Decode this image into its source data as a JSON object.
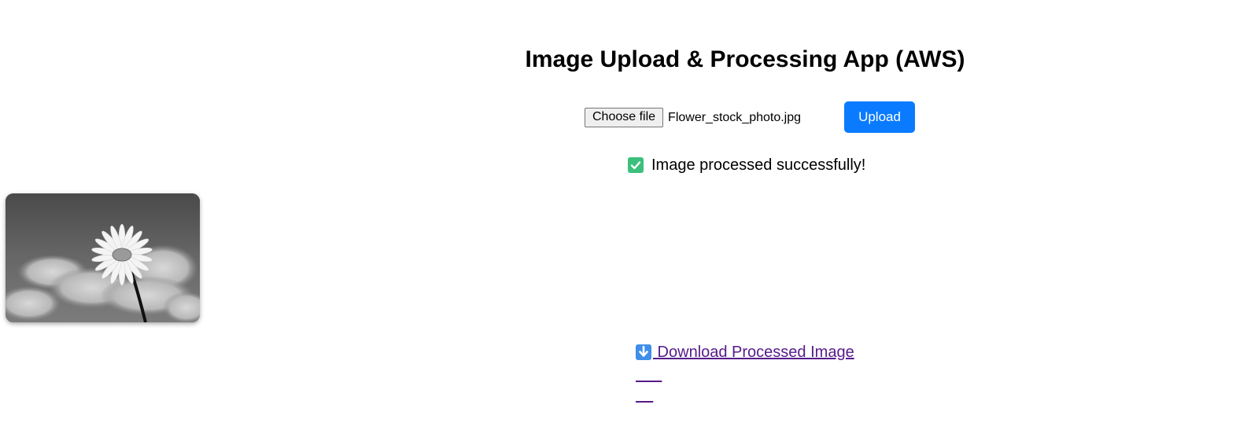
{
  "header": {
    "title": "Image Upload & Processing App (AWS)"
  },
  "upload_form": {
    "choose_file_label": "Choose file",
    "selected_file_name": "Flower_stock_photo.jpg",
    "upload_label": "Upload"
  },
  "status": {
    "icon": "check-mark-icon",
    "message": "Image processed successfully!"
  },
  "preview": {
    "description": "Processed grayscale image preview"
  },
  "download": {
    "icon": "down-arrow-icon",
    "label": " Download Processed Image"
  },
  "colors": {
    "upload_button": "#0a7bff",
    "success_icon": "#3cc07c",
    "link_visited": "#551a8b"
  }
}
